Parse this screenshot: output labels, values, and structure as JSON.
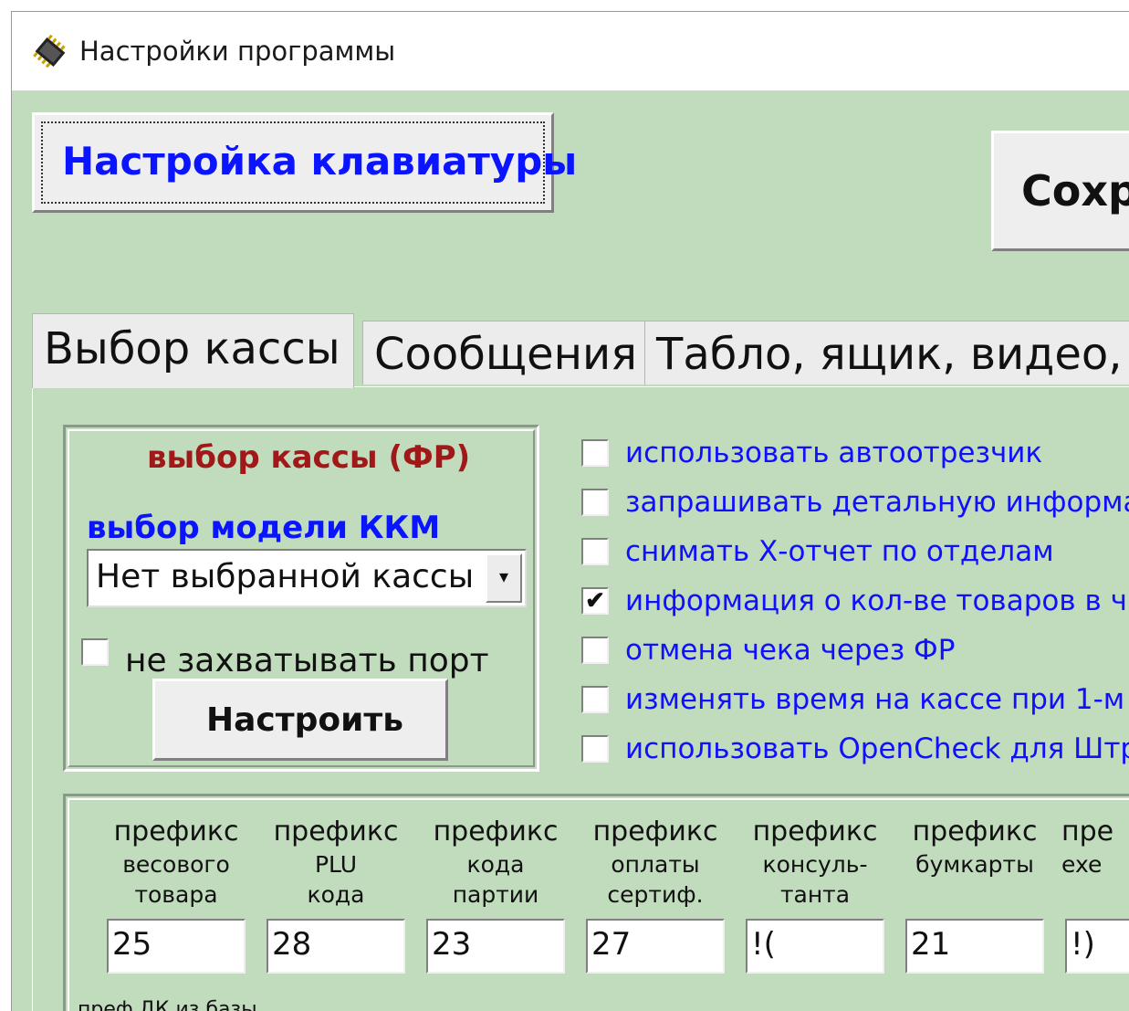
{
  "window": {
    "title": "Настройки программы",
    "icon": "chip-icon"
  },
  "toolbar": {
    "keyboard_button": "Настройка клавиатуры",
    "save_button": "Сохр"
  },
  "tabs": [
    {
      "label": "Выбор кассы",
      "active": true
    },
    {
      "label": "Сообщения",
      "active": false
    },
    {
      "label": "Табло, ящик, видео, в",
      "active": false
    }
  ],
  "kassa": {
    "group_title": "выбор кассы (ФР)",
    "model_label": "выбор модели ККМ",
    "model_value": "Нет выбранной кассы",
    "no_port_label": "не захватывать порт",
    "no_port_checked": false,
    "setup_button": "Настроить"
  },
  "options": [
    {
      "label": "использовать автоотрезчик",
      "checked": false
    },
    {
      "label": "запрашивать детальную информа",
      "checked": false
    },
    {
      "label": "снимать Х-отчет по отделам",
      "checked": false
    },
    {
      "label": "информация о кол-ве товаров в ч",
      "checked": true
    },
    {
      "label": "отмена чека через ФР",
      "checked": false
    },
    {
      "label": "изменять время на кассе при 1-м",
      "checked": false
    },
    {
      "label": "использовать OpenCheck для Штр",
      "checked": false
    }
  ],
  "prefixes": [
    {
      "l1": "префикс",
      "l2": "весового",
      "l3": "товара",
      "value": "25"
    },
    {
      "l1": "префикс",
      "l2": "PLU",
      "l3": "кода",
      "value": "28"
    },
    {
      "l1": "префикс",
      "l2": "кода",
      "l3": "партии",
      "value": "23"
    },
    {
      "l1": "префикс",
      "l2": "оплаты",
      "l3": "сертиф.",
      "value": "27"
    },
    {
      "l1": "префикс",
      "l2": "консуль-",
      "l3": "танта",
      "value": "!("
    },
    {
      "l1": "префикс",
      "l2": "бумкарты",
      "l3": "",
      "value": "21"
    },
    {
      "l1": "пре",
      "l2": "exe",
      "l3": "",
      "value": "!)"
    }
  ],
  "bottom_label": "преф ДК из базы",
  "check_mark": "✔",
  "dropdown_arrow": "▾"
}
